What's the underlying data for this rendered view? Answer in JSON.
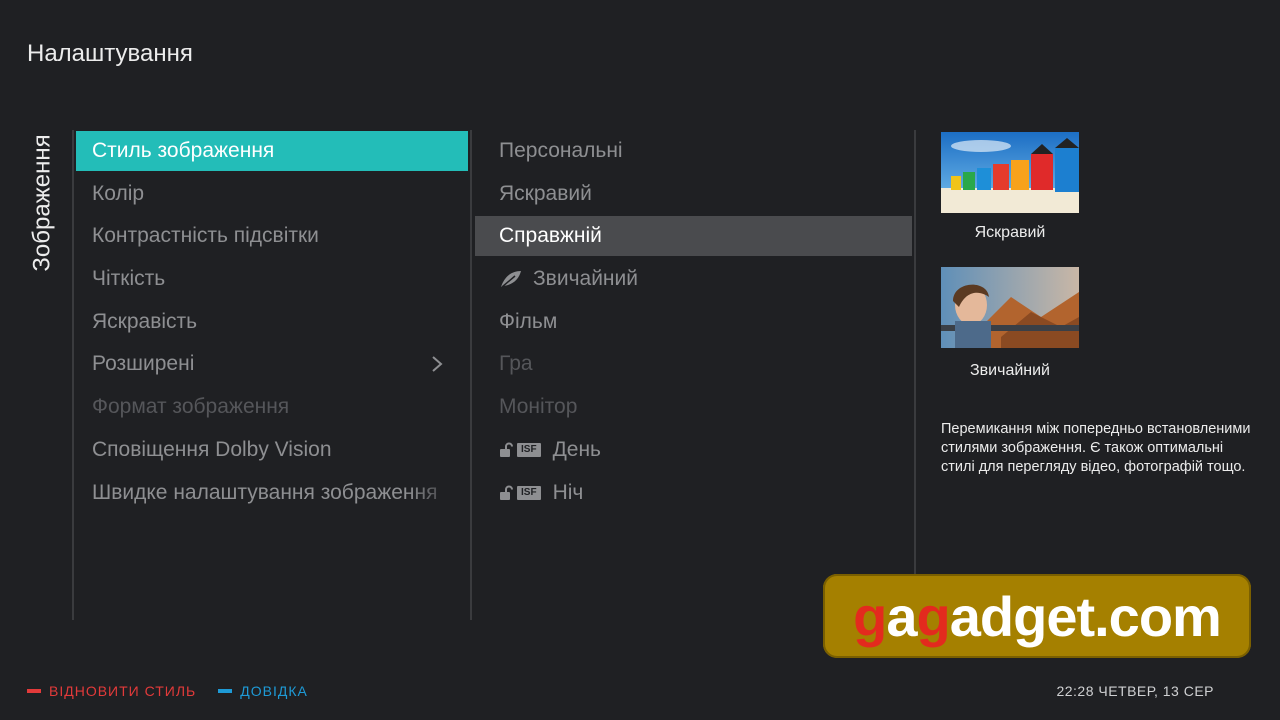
{
  "header": {
    "title": "Налаштування"
  },
  "section_label": "Зображення",
  "menu": {
    "items": [
      {
        "label": "Стиль зображення"
      },
      {
        "label": "Колір"
      },
      {
        "label": "Контрастність підсвітки"
      },
      {
        "label": "Чіткість"
      },
      {
        "label": "Яскравість"
      },
      {
        "label": "Розширені"
      },
      {
        "label": "Формат зображення"
      },
      {
        "label": "Сповіщення Dolby Vision"
      },
      {
        "label": "Швидке налаштування зображення"
      }
    ]
  },
  "options": {
    "items": [
      {
        "label": "Персональні"
      },
      {
        "label": "Яскравий"
      },
      {
        "label": "Справжній"
      },
      {
        "label": "Звичайний"
      },
      {
        "label": "Фільм"
      },
      {
        "label": "Гра"
      },
      {
        "label": "Монітор"
      },
      {
        "label": "День",
        "badge": "ISF"
      },
      {
        "label": "Ніч",
        "badge": "ISF"
      }
    ]
  },
  "preview": {
    "captions": [
      "Яскравий",
      "Звичайний"
    ],
    "description": "Перемикання між попередньо встановленими стилями зображення. Є також оптимальні стилі для перегляду відео, фотографій тощо."
  },
  "footer": {
    "reset_style": "ВІДНОВИТИ СТИЛЬ",
    "help": "ДОВІДКА",
    "clock": "22:28 ЧЕТВЕР, 13 СЕР"
  },
  "watermark": {
    "part1": "g",
    "part2": "a",
    "part3": "g",
    "part4": "adget.com"
  },
  "colors": {
    "accent": "#23bdb8",
    "selected": "#4a4b4e",
    "red": "#e23a3a",
    "blue": "#1e9ad6"
  }
}
